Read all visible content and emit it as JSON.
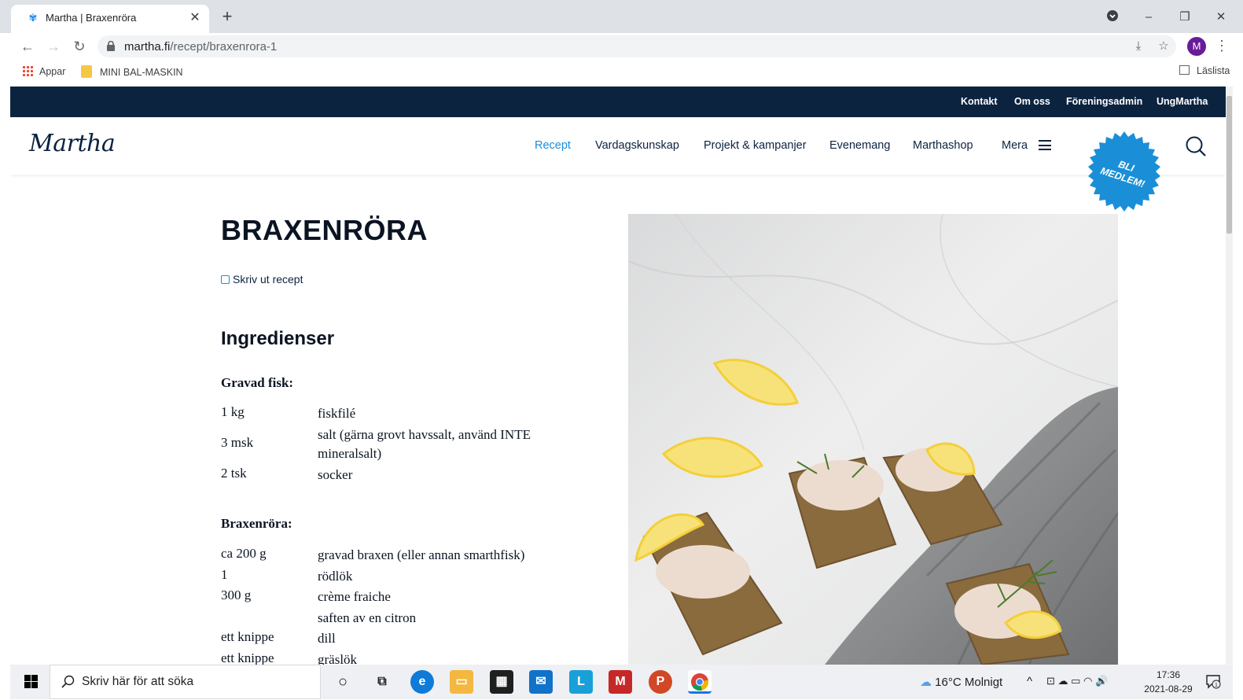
{
  "browser": {
    "tab_title": "Martha | Braxenröra",
    "url_domain": "martha.fi",
    "url_path": "/recept/braxenrora-1",
    "profile_initial": "M",
    "bookmarks": [
      {
        "label": "Appar"
      },
      {
        "label": "MINI BAL-MASKIN"
      }
    ],
    "reading_list_label": "Läslista"
  },
  "site": {
    "topbar_links": [
      "Kontakt",
      "Om oss",
      "Föreningsadmin",
      "UngMartha"
    ],
    "logo_text": "Martha",
    "nav_items": [
      "Recept",
      "Vardagskunskap",
      "Projekt & kampanjer",
      "Evenemang",
      "Marthashop",
      "Mera"
    ],
    "active_nav": "Recept",
    "badge_line1": "BLI",
    "badge_line2": "MEDLEM!",
    "recipe_title": "BRAXENRÖRA",
    "print_label": "Skriv ut recept",
    "ingredients_heading": "Ingredienser",
    "groups": [
      {
        "heading": "Gravad fisk:",
        "items": [
          {
            "amount": "1 kg",
            "name": "fiskfilé"
          },
          {
            "amount": "3 msk",
            "name": "salt (gärna grovt havssalt, använd INTE mineralsalt)"
          },
          {
            "amount": "2 tsk",
            "name": "socker"
          }
        ]
      },
      {
        "heading": "Braxenröra:",
        "items": [
          {
            "amount": "ca 200 g",
            "name": "gravad braxen (eller annan smarthfisk)"
          },
          {
            "amount": "1",
            "name": "rödlök"
          },
          {
            "amount": "300 g",
            "name": "crème fraiche"
          },
          {
            "amount": "",
            "name": "saften av en citron"
          },
          {
            "amount": "ett knippe",
            "name": "dill"
          },
          {
            "amount": "ett knippe",
            "name": "gräslök"
          }
        ]
      }
    ],
    "colors": {
      "navy": "#0c2340",
      "accent_blue": "#1a8fd8",
      "badge_blue": "#1a8fd8"
    }
  },
  "taskbar": {
    "search_placeholder": "Skriv här för att söka",
    "weather": "16°C  Molnigt",
    "time": "17:36",
    "date": "2021-08-29",
    "notification_count": "1"
  }
}
